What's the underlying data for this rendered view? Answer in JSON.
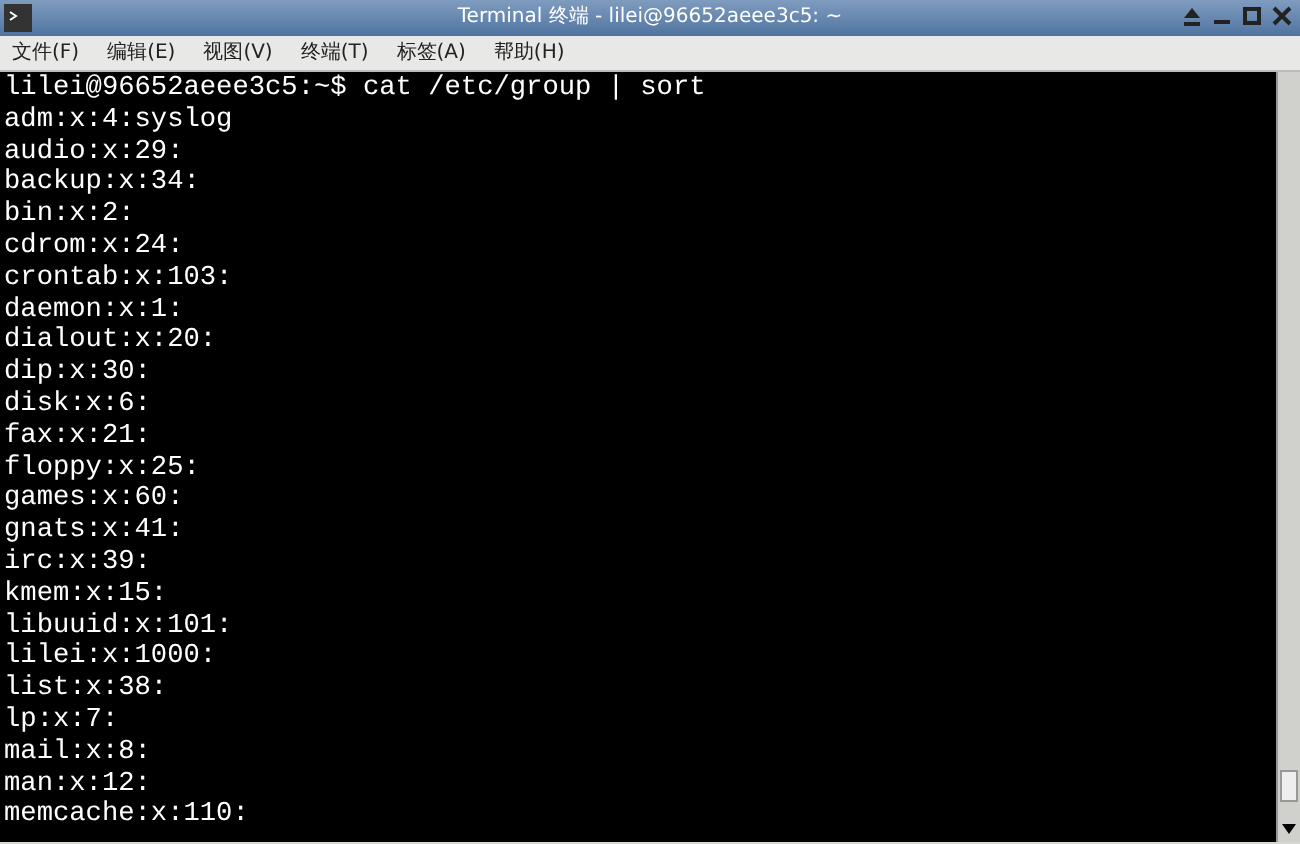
{
  "window": {
    "title": "Terminal 终端 - lilei@96652aeee3c5: ~"
  },
  "menu": [
    "文件(F)",
    "编辑(E)",
    "视图(V)",
    "终端(T)",
    "标签(A)",
    "帮助(H)"
  ],
  "terminal": {
    "lines": [
      "lilei@96652aeee3c5:~$ cat /etc/group | sort",
      "adm:x:4:syslog",
      "audio:x:29:",
      "backup:x:34:",
      "bin:x:2:",
      "cdrom:x:24:",
      "crontab:x:103:",
      "daemon:x:1:",
      "dialout:x:20:",
      "dip:x:30:",
      "disk:x:6:",
      "fax:x:21:",
      "floppy:x:25:",
      "games:x:60:",
      "gnats:x:41:",
      "irc:x:39:",
      "kmem:x:15:",
      "libuuid:x:101:",
      "lilei:x:1000:",
      "list:x:38:",
      "lp:x:7:",
      "mail:x:8:",
      "man:x:12:",
      "memcache:x:110:"
    ]
  }
}
